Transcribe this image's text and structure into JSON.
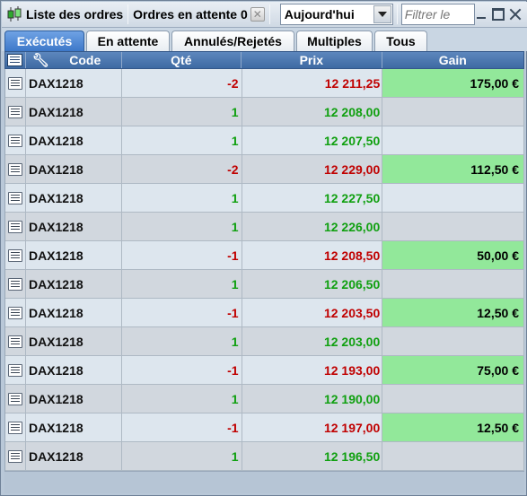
{
  "toolbar": {
    "title": "Liste des ordres",
    "pending_label": "Ordres en attente 0",
    "period_value": "Aujourd'hui",
    "filter_placeholder": "Filtrer le"
  },
  "tabs": [
    {
      "label": "Exécutés",
      "active": true
    },
    {
      "label": "En attente",
      "active": false
    },
    {
      "label": "Annulés/Rejetés",
      "active": false
    },
    {
      "label": "Multiples",
      "active": false
    },
    {
      "label": "Tous",
      "active": false
    }
  ],
  "columns": {
    "code": "Code",
    "qty": "Qté",
    "price": "Prix",
    "gain": "Gain"
  },
  "colors": {
    "negative": "#c00000",
    "positive": "#10a010",
    "gain_bg": "#92e89a",
    "header": "#4a76ae"
  },
  "rows": [
    {
      "code": "DAX1218",
      "qty": "-2",
      "price": "12 211,25",
      "gain": "175,00 €"
    },
    {
      "code": "DAX1218",
      "qty": "1",
      "price": "12 208,00",
      "gain": ""
    },
    {
      "code": "DAX1218",
      "qty": "1",
      "price": "12 207,50",
      "gain": ""
    },
    {
      "code": "DAX1218",
      "qty": "-2",
      "price": "12 229,00",
      "gain": "112,50 €"
    },
    {
      "code": "DAX1218",
      "qty": "1",
      "price": "12 227,50",
      "gain": ""
    },
    {
      "code": "DAX1218",
      "qty": "1",
      "price": "12 226,00",
      "gain": ""
    },
    {
      "code": "DAX1218",
      "qty": "-1",
      "price": "12 208,50",
      "gain": "50,00 €"
    },
    {
      "code": "DAX1218",
      "qty": "1",
      "price": "12 206,50",
      "gain": ""
    },
    {
      "code": "DAX1218",
      "qty": "-1",
      "price": "12 203,50",
      "gain": "12,50 €"
    },
    {
      "code": "DAX1218",
      "qty": "1",
      "price": "12 203,00",
      "gain": ""
    },
    {
      "code": "DAX1218",
      "qty": "-1",
      "price": "12 193,00",
      "gain": "75,00 €"
    },
    {
      "code": "DAX1218",
      "qty": "1",
      "price": "12 190,00",
      "gain": ""
    },
    {
      "code": "DAX1218",
      "qty": "-1",
      "price": "12 197,00",
      "gain": "12,50 €"
    },
    {
      "code": "DAX1218",
      "qty": "1",
      "price": "12 196,50",
      "gain": ""
    }
  ]
}
